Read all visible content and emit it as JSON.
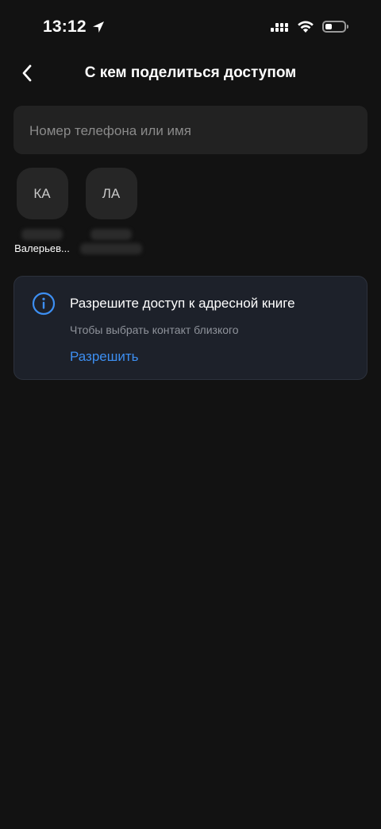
{
  "status_bar": {
    "time": "13:12",
    "battery_level": 0.35
  },
  "header": {
    "title": "С кем поделиться доступом"
  },
  "search": {
    "placeholder": "Номер телефона или имя",
    "value": ""
  },
  "contacts": [
    {
      "initials": "КА",
      "name": "Валерьев..."
    },
    {
      "initials": "ЛА",
      "name": ""
    }
  ],
  "info_card": {
    "title": "Разрешите доступ к адресной книге",
    "subtitle": "Чтобы выбрать контакт близкого",
    "action_label": "Разрешить"
  },
  "colors": {
    "background": "#121212",
    "accent": "#3d8ff2",
    "card": "#1d212a"
  }
}
